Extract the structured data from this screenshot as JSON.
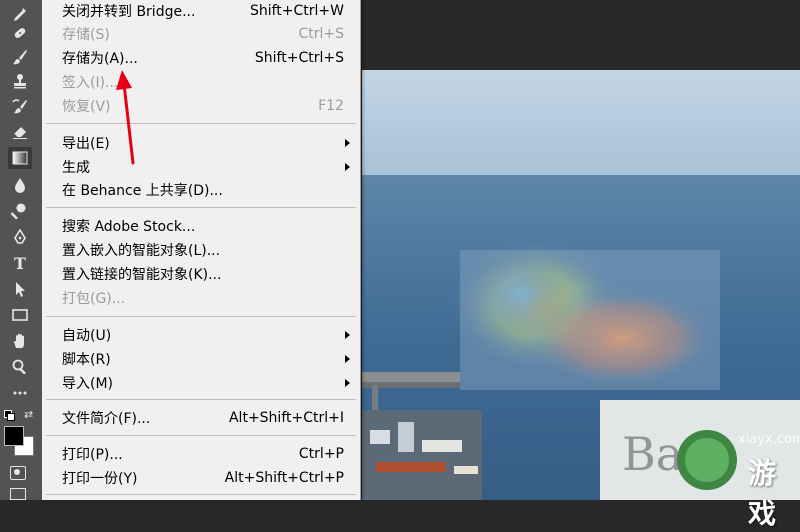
{
  "menu": {
    "items": [
      {
        "label": "关闭并转到 Bridge...",
        "shortcut": "Shift+Ctrl+W",
        "enabled": true
      },
      {
        "label": "存储(S)",
        "shortcut": "Ctrl+S",
        "enabled": false
      },
      {
        "label": "存储为(A)...",
        "shortcut": "Shift+Ctrl+S",
        "enabled": true
      },
      {
        "label": "签入(I)...",
        "shortcut": "",
        "enabled": false
      },
      {
        "label": "恢复(V)",
        "shortcut": "F12",
        "enabled": false
      },
      {
        "label": "导出(E)",
        "submenu": true,
        "enabled": true
      },
      {
        "label": "生成",
        "submenu": true,
        "enabled": true
      },
      {
        "label": "在 Behance 上共享(D)...",
        "enabled": true
      },
      {
        "label": "搜索 Adobe Stock...",
        "enabled": true
      },
      {
        "label": "置入嵌入的智能对象(L)...",
        "enabled": true
      },
      {
        "label": "置入链接的智能对象(K)...",
        "enabled": true
      },
      {
        "label": "打包(G)...",
        "enabled": false
      },
      {
        "label": "自动(U)",
        "submenu": true,
        "enabled": true
      },
      {
        "label": "脚本(R)",
        "submenu": true,
        "enabled": true
      },
      {
        "label": "导入(M)",
        "submenu": true,
        "enabled": true
      },
      {
        "label": "文件简介(F)...",
        "shortcut": "Alt+Shift+Ctrl+I",
        "enabled": true
      },
      {
        "label": "打印(P)...",
        "shortcut": "Ctrl+P",
        "enabled": true
      },
      {
        "label": "打印一份(Y)",
        "shortcut": "Alt+Shift+Ctrl+P",
        "enabled": true
      }
    ]
  },
  "toolbar": {
    "tools": [
      "color-sampler-icon",
      "healing-brush-icon",
      "brush-icon",
      "clone-stamp-icon",
      "history-brush-icon",
      "eraser-icon",
      "gradient-icon",
      "blur-icon",
      "dodge-icon",
      "pen-icon",
      "type-icon",
      "path-selection-icon",
      "rectangle-icon",
      "hand-icon",
      "zoom-icon",
      "more-tools-icon"
    ]
  },
  "watermark": {
    "site": "xiayx.com",
    "logo_text": "游戏"
  },
  "colors": {
    "menu_bg": "#f0f0f0",
    "toolbar_bg": "#535353",
    "annotation": "#e60012"
  }
}
